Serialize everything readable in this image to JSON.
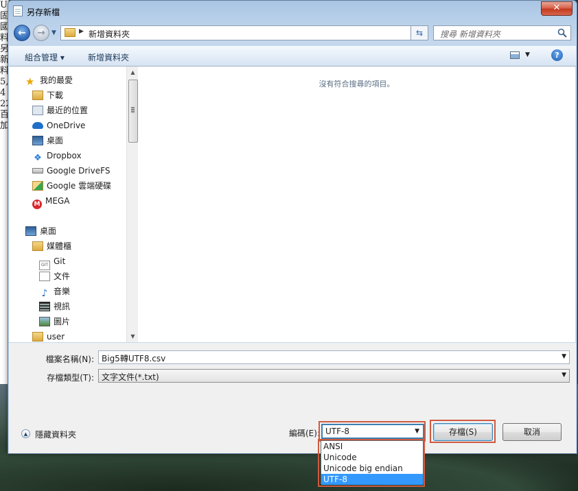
{
  "background": {
    "doc_fragment_lines": [
      "UI",
      "",
      "固",
      "國",
      "料",
      "另",
      "新",
      "料",
      "5,",
      "4",
      "22",
      "百",
      "加"
    ]
  },
  "window": {
    "title": "另存新檔",
    "close_symbol": "✕"
  },
  "address": {
    "current_folder": "新增資料夾",
    "search_placeholder": "搜尋 新增資料夾"
  },
  "toolbar": {
    "organize_label": "組合管理 ▾",
    "new_folder_label": "新增資料夾",
    "help_symbol": "?"
  },
  "nav": {
    "favorites_header": "我的最愛",
    "favorites": [
      "下載",
      "最近的位置",
      "OneDrive",
      "桌面",
      "Dropbox",
      "Google DriveFS",
      "Google 雲端硬碟",
      "MEGA"
    ],
    "desktop_header": "桌面",
    "libraries_label": "媒體櫃",
    "libraries": [
      "Git",
      "文件",
      "音樂",
      "視訊",
      "圖片"
    ],
    "user_label": "user"
  },
  "file_list": {
    "empty_message": "沒有符合搜尋的項目。"
  },
  "form": {
    "filename_label": "檔案名稱(N):",
    "filename_value": "Big5轉UTF8.csv",
    "filetype_label": "存檔類型(T):",
    "filetype_value": "文字文件(*.txt)",
    "hide_folders_label": "隱藏資料夾",
    "encoding_label": "編碼(E):",
    "encoding_value": "UTF-8",
    "save_label": "存檔(S)",
    "cancel_label": "取消"
  },
  "encoding_options": [
    "ANSI",
    "Unicode",
    "Unicode big endian",
    "UTF-8"
  ],
  "encoding_selected_index": 3,
  "colors": {
    "highlight_outline": "#cf5a3f",
    "selection": "#3399ff"
  }
}
